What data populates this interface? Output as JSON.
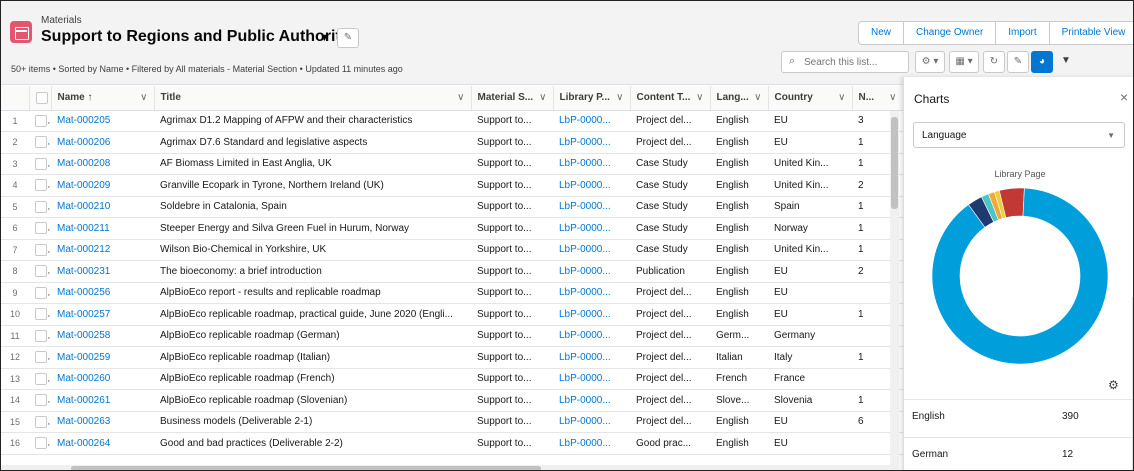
{
  "header": {
    "object_label": "Materials",
    "list_title": "Support to Regions and Public Authoritie",
    "title_caret": "▼",
    "pin_icon": "pin-icon",
    "status": "50+ items • Sorted by Name • Filtered by All materials - Material Section • Updated 11 minutes ago",
    "buttons": [
      "New",
      "Change Owner",
      "Import",
      "Printable View"
    ],
    "search_placeholder": "Search this list..."
  },
  "table": {
    "columns": [
      {
        "label": ""
      },
      {
        "label": ""
      },
      {
        "label": "Name ↑"
      },
      {
        "label": "Title"
      },
      {
        "label": "Material S..."
      },
      {
        "label": "Library P..."
      },
      {
        "label": "Content T..."
      },
      {
        "label": "Lang..."
      },
      {
        "label": "Country"
      },
      {
        "label": "N..."
      }
    ],
    "rows": [
      {
        "n": "1",
        "name": "Mat-000205",
        "title": "Agrimax D1.2 Mapping of AFPW and their characteristics",
        "section": "Support to...",
        "library": "LbP-0000...",
        "content": "Project del...",
        "lang": "English",
        "country": "EU",
        "num": "3"
      },
      {
        "n": "2",
        "name": "Mat-000206",
        "title": "Agrimax D7.6 Standard and legislative aspects",
        "section": "Support to...",
        "library": "LbP-0000...",
        "content": "Project del...",
        "lang": "English",
        "country": "EU",
        "num": "1"
      },
      {
        "n": "3",
        "name": "Mat-000208",
        "title": "AF Biomass Limited in East Anglia, UK",
        "section": "Support to...",
        "library": "LbP-0000...",
        "content": "Case Study",
        "lang": "English",
        "country": "United Kin...",
        "num": "1"
      },
      {
        "n": "4",
        "name": "Mat-000209",
        "title": "Granville Ecopark in Tyrone, Northern Ireland (UK)",
        "section": "Support to...",
        "library": "LbP-0000...",
        "content": "Case Study",
        "lang": "English",
        "country": "United Kin...",
        "num": "2"
      },
      {
        "n": "5",
        "name": "Mat-000210",
        "title": "Soldebre in Catalonia, Spain",
        "section": "Support to...",
        "library": "LbP-0000...",
        "content": "Case Study",
        "lang": "English",
        "country": "Spain",
        "num": "1"
      },
      {
        "n": "6",
        "name": "Mat-000211",
        "title": "Steeper Energy and Silva Green Fuel in Hurum, Norway",
        "section": "Support to...",
        "library": "LbP-0000...",
        "content": "Case Study",
        "lang": "English",
        "country": "Norway",
        "num": "1"
      },
      {
        "n": "7",
        "name": "Mat-000212",
        "title": "Wilson Bio-Chemical in Yorkshire, UK",
        "section": "Support to...",
        "library": "LbP-0000...",
        "content": "Case Study",
        "lang": "English",
        "country": "United Kin...",
        "num": "1"
      },
      {
        "n": "8",
        "name": "Mat-000231",
        "title": "The bioeconomy: a brief introduction",
        "section": "Support to...",
        "library": "LbP-0000...",
        "content": "Publication",
        "lang": "English",
        "country": "EU",
        "num": "2"
      },
      {
        "n": "9",
        "name": "Mat-000256",
        "title": "AlpBioEco report - results and replicable roadmap",
        "section": "Support to...",
        "library": "LbP-0000...",
        "content": "Project del...",
        "lang": "English",
        "country": "EU",
        "num": ""
      },
      {
        "n": "10",
        "name": "Mat-000257",
        "title": "AlpBioEco replicable roadmap, practical guide, June 2020 (Engli...",
        "section": "Support to...",
        "library": "LbP-0000...",
        "content": "Project del...",
        "lang": "English",
        "country": "EU",
        "num": "1"
      },
      {
        "n": "11",
        "name": "Mat-000258",
        "title": "AlpBioEco replicable roadmap (German)",
        "section": "Support to...",
        "library": "LbP-0000...",
        "content": "Project del...",
        "lang": "Germ...",
        "country": "Germany",
        "num": ""
      },
      {
        "n": "12",
        "name": "Mat-000259",
        "title": "AlpBioEco replicable roadmap (Italian)",
        "section": "Support to...",
        "library": "LbP-0000...",
        "content": "Project del...",
        "lang": "Italian",
        "country": "Italy",
        "num": "1"
      },
      {
        "n": "13",
        "name": "Mat-000260",
        "title": "AlpBioEco replicable roadmap (French)",
        "section": "Support to...",
        "library": "LbP-0000...",
        "content": "Project del...",
        "lang": "French",
        "country": "France",
        "num": ""
      },
      {
        "n": "14",
        "name": "Mat-000261",
        "title": "AlpBioEco replicable roadmap (Slovenian)",
        "section": "Support to...",
        "library": "LbP-0000...",
        "content": "Project del...",
        "lang": "Slove...",
        "country": "Slovenia",
        "num": "1"
      },
      {
        "n": "15",
        "name": "Mat-000263",
        "title": "Business models (Deliverable 2-1)",
        "section": "Support to...",
        "library": "LbP-0000...",
        "content": "Project del...",
        "lang": "English",
        "country": "EU",
        "num": "6"
      },
      {
        "n": "16",
        "name": "Mat-000264",
        "title": "Good and bad practices (Deliverable 2-2)",
        "section": "Support to...",
        "library": "LbP-0000...",
        "content": "Good prac...",
        "lang": "English",
        "country": "EU",
        "num": ""
      }
    ]
  },
  "charts_panel": {
    "title": "Charts",
    "close": "×",
    "selected": "Language",
    "subtitle": "Library Page",
    "legend": [
      {
        "name": "English",
        "value": "390"
      },
      {
        "name": "German",
        "value": "12"
      }
    ]
  },
  "chart_data": {
    "type": "pie",
    "title": "Library Page",
    "donut": true,
    "slices": [
      {
        "value": 390,
        "color": "#009edb"
      },
      {
        "value": 12,
        "color": "#1f3a6e"
      },
      {
        "value": 6,
        "color": "#4bc6c2"
      },
      {
        "value": 5,
        "color": "#f2a73b"
      },
      {
        "value": 4,
        "color": "#e7d03a"
      },
      {
        "value": 20,
        "color": "#c23934"
      }
    ]
  },
  "colors": {
    "brand": "#0176d3",
    "object_icon": "#e3566f"
  }
}
